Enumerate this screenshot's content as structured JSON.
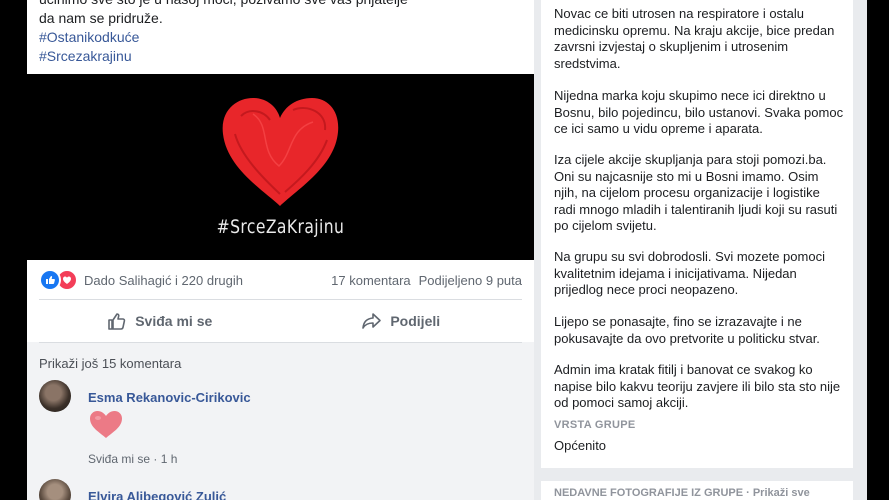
{
  "post": {
    "text_line_top": "da nam se pridruže.",
    "text_cutoff": "učinimo sve što je u našoj moći, pozivamo sve vas prijatelje",
    "hashtags": [
      "#Ostanikodkuće",
      "#Srcezakrajinu"
    ],
    "image_caption": "#SrceZaKrajinu",
    "reactions_text": "Dado Salihagić i 220 drugih",
    "comments_count": "17 komentara",
    "shares_count": "Podijeljeno 9 puta",
    "like_label": "Sviđa mi se",
    "share_label": "Podijeli",
    "more_comments": "Prikaži još 15 komentara",
    "comments": [
      {
        "name": "Esma Rekanovic-Cirikovic",
        "like": "Sviđa mi se",
        "time": "1 h"
      },
      {
        "name": "Elvira Alibegović Zulić"
      }
    ],
    "colors": {
      "like": "#1877f2",
      "love": "#f33e58",
      "heart": "#e8262a"
    }
  },
  "sidebar": {
    "paragraphs": [
      "Novac ce biti utrosen na respiratore i ostalu medicinsku opremu. Na kraju akcije, bice predan zavrsni izvjestaj o skupljenim i utrosenim sredstvima.",
      "Nijedna marka koju skupimo nece ici direktno u Bosnu, bilo pojedincu, bilo ustanovi. Svaka pomoc ce ici samo u vidu opreme i aparata.",
      "Iza cijele akcije skupljanja para stoji pomozi.ba. Oni su najcasnije sto mi u Bosni imamo. Osim njih, na cijelom procesu organizacije i logistike radi mnogo mladih i talentiranih ljudi koji su rasuti po cijelom svijetu.",
      "Na grupu su svi dobrodosli. Svi mozete pomoci kvalitetnim idejama i inicijativama. Nijedan prijedlog nece proci neopazeno.",
      "Lijepo se ponasajte, fino se izrazavajte i ne pokusavajte da ovo pretvorite u politicku stvar.",
      "Admin ima kratak fitilj i banovat ce svakog ko napise bilo kakvu teoriju zavjere ili bilo sta sto nije od pomoci samoj akciji."
    ],
    "group_type_label": "VRSTA GRUPE",
    "group_type_value": "Općenito",
    "next_section": "NEDAVNE FOTOGRAFIJE IZ GRUPE · Prikaži sve"
  }
}
